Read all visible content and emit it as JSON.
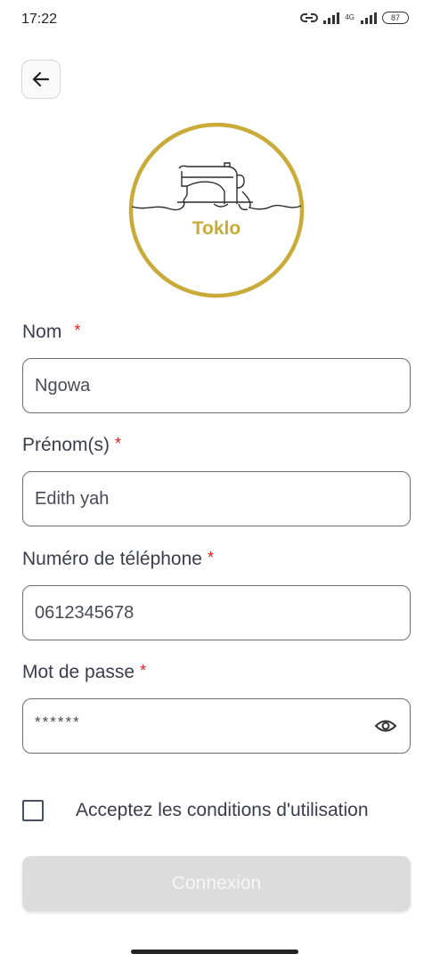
{
  "status_bar": {
    "time": "17:22",
    "network_label": "4G",
    "battery": "87"
  },
  "logo": {
    "text": "Toklo",
    "accent_color": "#c9ab3a"
  },
  "form": {
    "nom": {
      "label": "Nom",
      "value": "Ngowa"
    },
    "prenom": {
      "label": "Prénom(s)",
      "value": "Edith yah"
    },
    "telephone": {
      "label": "Numéro de téléphone",
      "value": "0612345678"
    },
    "password": {
      "label": "Mot de passe",
      "value": "******"
    },
    "required_marker": "*"
  },
  "terms": {
    "label": "Acceptez les conditions d'utilisation",
    "checked": false
  },
  "submit": {
    "label": "Connexion",
    "disabled": true
  },
  "colors": {
    "required": "#e02020",
    "button_disabled": "#dcdcdc"
  }
}
